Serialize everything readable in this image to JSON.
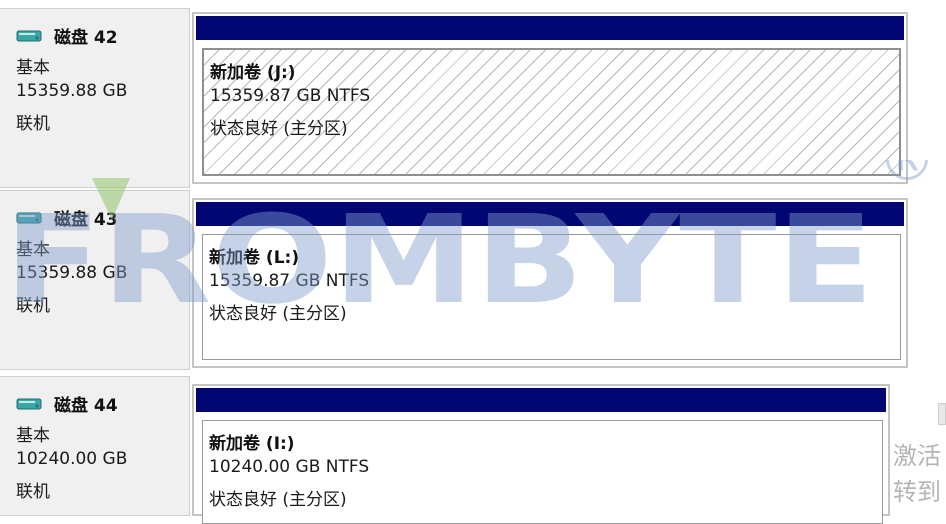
{
  "disks": [
    {
      "name": "磁盘 42",
      "type": "基本",
      "capacity": "15359.88 GB",
      "state": "联机",
      "volume": {
        "name": "新加卷  (J:)",
        "size": "15359.87 GB NTFS",
        "status": "状态良好 (主分区)",
        "selected": true
      }
    },
    {
      "name": "磁盘 43",
      "type": "基本",
      "capacity": "15359.88 GB",
      "state": "联机",
      "volume": {
        "name": "新加卷  (L:)",
        "size": "15359.87 GB NTFS",
        "status": "状态良好 (主分区)",
        "selected": false
      }
    },
    {
      "name": "磁盘 44",
      "type": "基本",
      "capacity": "10240.00 GB",
      "state": "联机",
      "volume": {
        "name": "新加卷  (I:)",
        "size": "10240.00 GB NTFS",
        "status": "状态良好 (主分区)",
        "selected": false
      }
    }
  ],
  "watermark": {
    "text": "FROMBYTE",
    "mark": "®"
  },
  "background_text": {
    "line1": "激活",
    "line2": "转到"
  },
  "colors": {
    "volume_bar": "#020673",
    "disk_panel": "#f0f0f0",
    "disk_icon": "#3aa6a6",
    "watermark_blue": "#7f9cc9",
    "watermark_green": "#8fc46a"
  },
  "icons": {
    "disk": "disk-drive-icon"
  }
}
